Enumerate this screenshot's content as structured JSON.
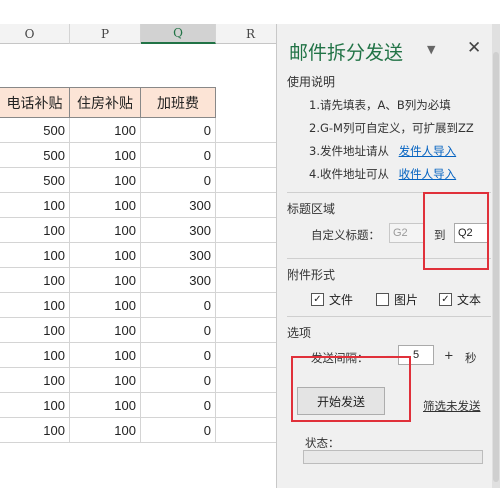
{
  "sheet": {
    "columns": [
      "O",
      "P",
      "Q",
      "R"
    ],
    "selected_column": "Q",
    "headers": [
      "电话补贴",
      "住房补贴",
      "加班费"
    ],
    "rows": [
      [
        "500",
        "100",
        "0"
      ],
      [
        "500",
        "100",
        "0"
      ],
      [
        "500",
        "100",
        "0"
      ],
      [
        "100",
        "100",
        "300"
      ],
      [
        "100",
        "100",
        "300"
      ],
      [
        "100",
        "100",
        "300"
      ],
      [
        "100",
        "100",
        "300"
      ],
      [
        "100",
        "100",
        "0"
      ],
      [
        "100",
        "100",
        "0"
      ],
      [
        "100",
        "100",
        "0"
      ],
      [
        "100",
        "100",
        "0"
      ],
      [
        "100",
        "100",
        "0"
      ],
      [
        "100",
        "100",
        "0"
      ]
    ],
    "header_fill": "#fce4d6"
  },
  "pane": {
    "title": "邮件拆分发送",
    "caret": "▼",
    "close": "✕",
    "usage": {
      "label": "使用说明",
      "line1": "1.请先填表，A、B列为必填",
      "line2": "2.G-M列可自定义，可扩展到ZZ",
      "line3_text": "3.发件地址请从",
      "line3_link": "发件人导入",
      "line4_text": "4.收件地址可从",
      "line4_link": "收件人导入"
    },
    "title_area": {
      "label": "标题区域",
      "custom_label": "自定义标题：",
      "from_value": "G2",
      "to_label": "到",
      "to_value": "Q2"
    },
    "attachment": {
      "label": "附件形式",
      "options": [
        {
          "label": "文件",
          "checked": true
        },
        {
          "label": "图片",
          "checked": false
        },
        {
          "label": "文本",
          "checked": true
        }
      ]
    },
    "options": {
      "label": "选项",
      "interval_label": "发送间隔：",
      "minus": "−",
      "interval_value": "5",
      "plus": "+",
      "unit": "秒"
    },
    "start_button": "开始发送",
    "filter_link": "筛选未发送",
    "status_label": "状态：",
    "accent_color": "#217346",
    "highlight_color": "#e0303a"
  }
}
